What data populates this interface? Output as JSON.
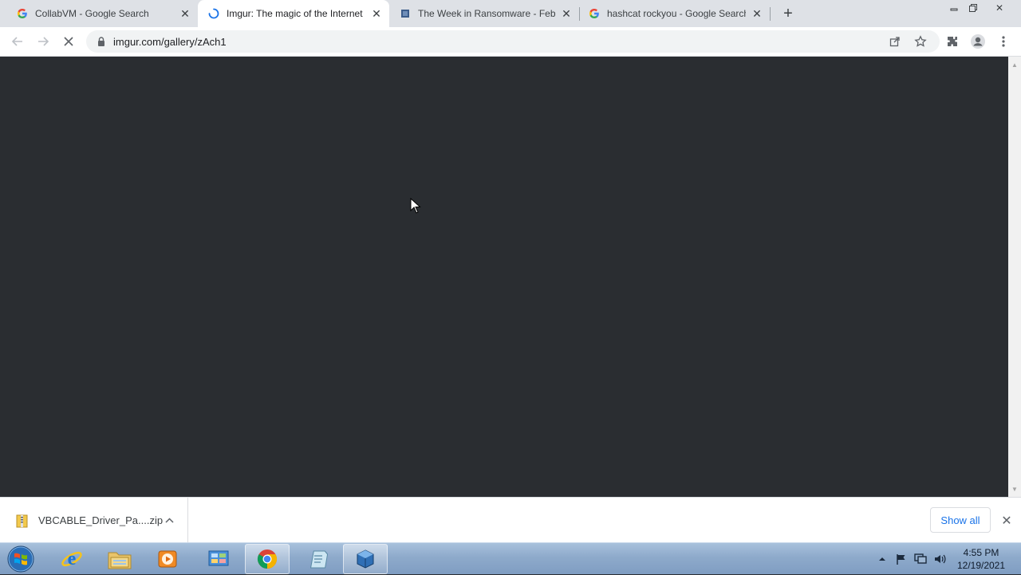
{
  "tabs": [
    {
      "title": "CollabVM - Google Search",
      "favicon": "google-g-icon"
    },
    {
      "title": "Imgur: The magic of the Internet",
      "favicon": "loading-spinner-icon",
      "active": true
    },
    {
      "title": "The Week in Ransomware - February",
      "favicon": "site-favicon-icon"
    },
    {
      "title": "hashcat rockyou - Google Search",
      "favicon": "google-g-icon"
    }
  ],
  "address_bar": {
    "url": "imgur.com/gallery/zAch1"
  },
  "download": {
    "filename": "VBCABLE_Driver_Pa....zip",
    "show_all_label": "Show all"
  },
  "taskbar": {
    "apps": [
      "internet-explorer-icon",
      "file-explorer-icon",
      "media-player-icon",
      "control-panel-icon",
      "chrome-icon",
      "notepad-icon",
      "virtualbox-icon"
    ],
    "clock_time": "4:55 PM",
    "clock_date": "12/19/2021"
  },
  "colors": {
    "page_bg": "#2a2d31",
    "tab_strip": "#dee1e6",
    "link_blue": "#1a73e8"
  }
}
